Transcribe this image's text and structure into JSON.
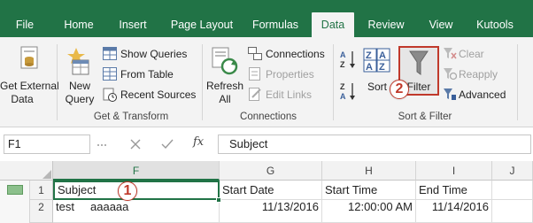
{
  "tabs": [
    "File",
    "Home",
    "Insert",
    "Page Layout",
    "Formulas",
    "Data",
    "Review",
    "View",
    "Kutools"
  ],
  "active_tab": "Data",
  "ribbon": {
    "get_transform": {
      "get_external_line1": "Get External",
      "get_external_line2": "Data",
      "new_query_line1": "New",
      "new_query_line2": "Query",
      "show_queries": "Show Queries",
      "from_table": "From Table",
      "recent_sources": "Recent Sources",
      "label": "Get & Transform"
    },
    "connections": {
      "refresh_line1": "Refresh",
      "refresh_line2": "All",
      "connections": "Connections",
      "properties": "Properties",
      "edit_links": "Edit Links",
      "label": "Connections"
    },
    "sort_filter": {
      "sort": "Sort",
      "filter": "Filter",
      "clear": "Clear",
      "reapply": "Reapply",
      "advanced": "Advanced",
      "label": "Sort & Filter"
    }
  },
  "formula_bar": {
    "name_box": "F1",
    "fx": "fx",
    "formula": "Subject"
  },
  "grid": {
    "columns": [
      "F",
      "G",
      "H",
      "I",
      "J"
    ],
    "rows": [
      {
        "num": "1",
        "cells": [
          "Subject",
          "Start Date",
          "Start Time",
          "End Time"
        ]
      },
      {
        "num": "2",
        "cells": [
          "test     aaaaaa",
          "11/13/2016",
          "12:00:00 AM",
          "11/14/2016"
        ]
      }
    ]
  },
  "callouts": [
    "1",
    "2"
  ],
  "colors": {
    "accent": "#217346",
    "callout": "#c0392b",
    "filter_highlight": "#c0392b"
  }
}
